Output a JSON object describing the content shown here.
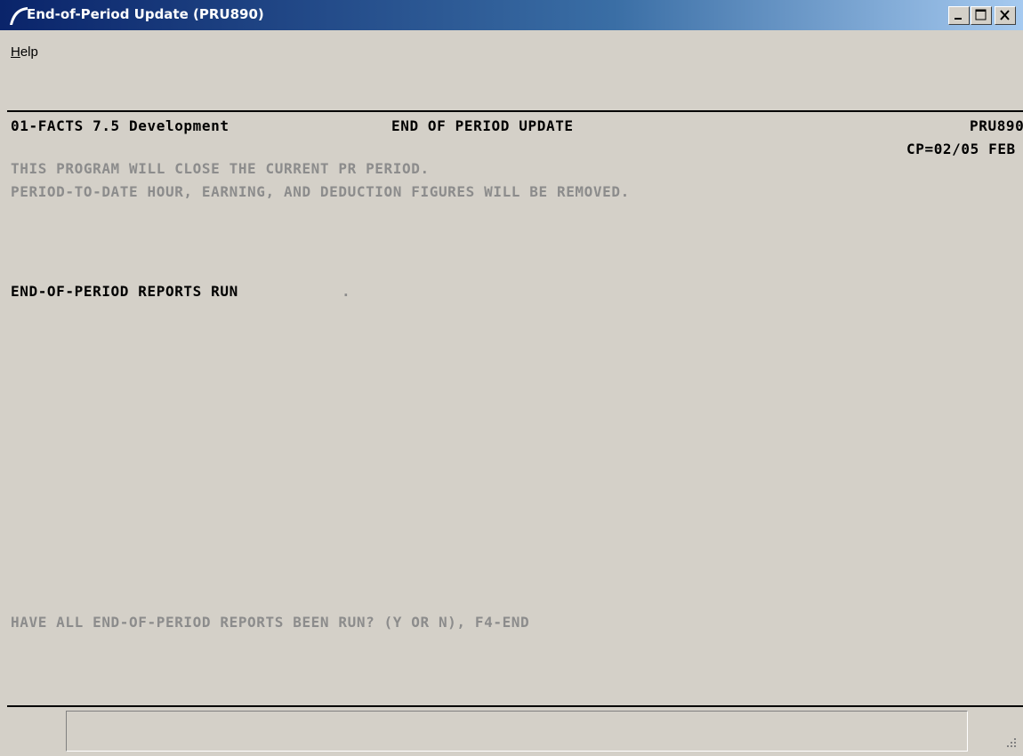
{
  "window": {
    "title": "End-of-Period Update (PRU890)",
    "controls": {
      "minimize": "minimize",
      "maximize": "maximize",
      "close": "close"
    }
  },
  "menu": {
    "items": [
      {
        "first": "H",
        "rest": "elp"
      }
    ]
  },
  "screen": {
    "company": "01-FACTS 7.5 Development",
    "heading": "END OF PERIOD UPDATE",
    "program_code": "PRU890",
    "current_period": "CP=02/05 FEB",
    "info_line1": "THIS PROGRAM WILL CLOSE THE CURRENT PR PERIOD.",
    "info_line2": "PERIOD-TO-DATE HOUR, EARNING, AND DEDUCTION FIGURES WILL BE REMOVED.",
    "field_label": "END-OF-PERIOD REPORTS RUN",
    "field_value": ".",
    "prompt": "HAVE ALL END-OF-PERIOD REPORTS BEEN RUN? (Y OR N), F4-END"
  },
  "status": {
    "text": ""
  },
  "colors": {
    "title_bar": "#0a246a",
    "background": "#d4d0c8",
    "prompt_gray": "#8c8c8c"
  }
}
